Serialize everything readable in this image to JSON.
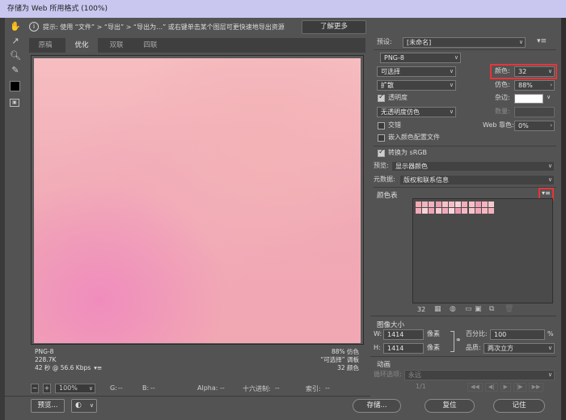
{
  "window": {
    "title": "存储为 Web 所用格式 (100%)"
  },
  "tip": {
    "text": "提示: 使用 “文件” > “导出” > “导出为…” 或右键单击某个图层可更快速地导出资源",
    "learn_more": "了解更多"
  },
  "tabs": [
    "原稿",
    "优化",
    "双联",
    "四联"
  ],
  "preview_stats": {
    "format": "PNG-8",
    "size": "228.7K",
    "time": "42 秒 @ 56.6 Kbps",
    "dither": "88% 仿色",
    "palette": "“可选择” 调板",
    "colors": "32 颜色"
  },
  "bottom_bar": {
    "zoom": "100%",
    "g_label": "G:",
    "g_val": "--",
    "b_label": "B:",
    "b_val": "--",
    "alpha_label": "Alpha:",
    "alpha_val": "--",
    "hex_label": "十六进制:",
    "hex_val": "--",
    "index_label": "索引:",
    "index_val": "--"
  },
  "buttons": {
    "preview": "预览...",
    "save": "存储...",
    "reset": "复位",
    "done": "记住"
  },
  "settings": {
    "preset_label": "预设:",
    "preset_value": "[未命名]",
    "format": "PNG-8",
    "reduction": "可选择",
    "colors_label": "颜色:",
    "colors_value": "32",
    "dither_algo": "扩散",
    "dither_label": "仿色:",
    "dither_value": "88%",
    "transparency": "透明度",
    "matte_label": "杂边:",
    "transparency_dither": "无透明度仿色",
    "amount_label": "数量:",
    "interlaced": "交错",
    "websnap_label": "Web 靠色:",
    "websnap_value": "0%",
    "embed_profile": "嵌入颜色配置文件",
    "convert_srgb": "转换为 sRGB",
    "preview_label": "预览:",
    "preview_value": "显示器颜色",
    "metadata_label": "元数据:",
    "metadata_value": "版权和联系信息"
  },
  "color_table": {
    "title": "颜色表",
    "count": "32",
    "swatches": [
      "#f4a7b0",
      "#f1b5bf",
      "#f3b0bd",
      "#ed9fb0",
      "#f6c3c8",
      "#f5bcc4",
      "#f8cfd4",
      "#f4adb9",
      "#f6c0c6",
      "#ef9db4",
      "#f5b4c0",
      "#f7c8cd",
      "#f2aab8",
      "#f8d5d7",
      "#f0a3b6",
      "#f7cbd0",
      "#f1abbe",
      "#f9d8db",
      "#ee99b3",
      "#f3b8c2",
      "#f5c5ca",
      "#f0a6b8",
      "#f6b9c2",
      "#f2b2bf"
    ]
  },
  "image_size": {
    "title": "图像大小",
    "w_label": "W:",
    "w_value": "1414",
    "h_label": "H:",
    "h_value": "1414",
    "unit": "像素",
    "percent_label": "百分比:",
    "percent_value": "100",
    "percent_sign": "%",
    "quality_label": "品质:",
    "quality_value": "两次立方"
  },
  "animation": {
    "title": "动画",
    "loop_label": "循环选项:",
    "loop_value": "永远",
    "frame": "1/1"
  }
}
